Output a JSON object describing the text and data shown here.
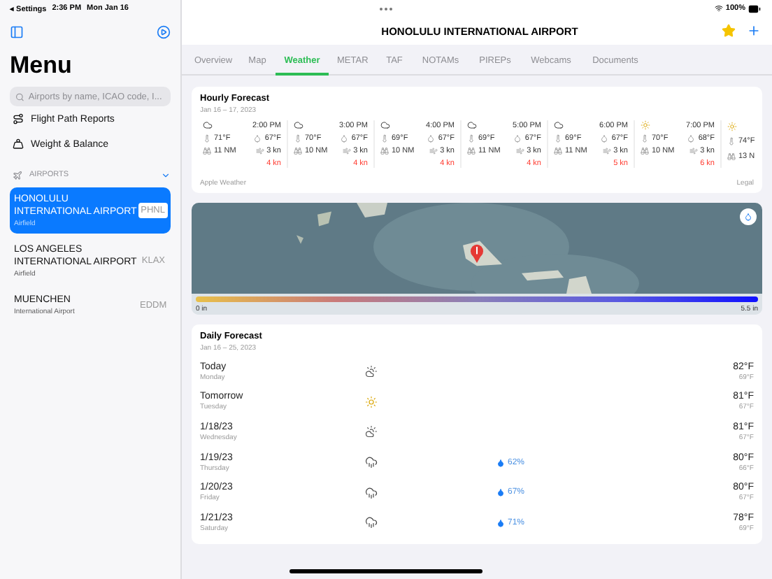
{
  "status_bar": {
    "back": "◂ Settings",
    "time": "2:36 PM",
    "date": "Mon Jan 16",
    "battery": "100%"
  },
  "sidebar": {
    "title": "Menu",
    "search": {
      "placeholder": "Airports by name, ICAO code, I..."
    },
    "items": [
      {
        "label": "Flight Path Reports",
        "kind": "route"
      },
      {
        "label": "Weight & Balance",
        "kind": "weight"
      }
    ],
    "section": {
      "label": "AIRPORTS",
      "expanded": true
    },
    "airports": [
      {
        "name": "HONOLULU INTERNATIONAL AIRPORT",
        "type": "Airfield",
        "code": "PHNL",
        "selected": true
      },
      {
        "name": "LOS ANGELES INTERNATIONAL AIRPORT",
        "type": "Airfield",
        "code": "KLAX",
        "selected": false
      },
      {
        "name": "MUENCHEN",
        "type": "International Airport",
        "code": "EDDM",
        "selected": false
      }
    ]
  },
  "header": {
    "title": "HONOLULU INTERNATIONAL AIRPORT",
    "favorite": true
  },
  "tabs": [
    {
      "label": "Overview",
      "selected": false
    },
    {
      "label": "Map",
      "selected": false
    },
    {
      "label": "Weather",
      "selected": true
    },
    {
      "label": "METAR",
      "selected": false
    },
    {
      "label": "TAF",
      "selected": false
    },
    {
      "label": "NOTAMs",
      "selected": false
    },
    {
      "label": "PIREPs",
      "selected": false
    },
    {
      "label": "Webcams",
      "selected": false
    },
    {
      "label": "Documents",
      "selected": false
    }
  ],
  "hourly": {
    "title": "Hourly Forecast",
    "range": "Jan 16 – 17, 2023",
    "source": "Apple Weather",
    "legal": "Legal",
    "hours": [
      {
        "kind": "cloudy",
        "time": "2:00 PM",
        "temp": "71°F",
        "dewpoint": "67°F",
        "visibility": "11 NM",
        "wind": "3 kn",
        "gust": "4 kn"
      },
      {
        "kind": "cloudy",
        "time": "3:00 PM",
        "temp": "70°F",
        "dewpoint": "67°F",
        "visibility": "10 NM",
        "wind": "3 kn",
        "gust": "4 kn"
      },
      {
        "kind": "cloudy",
        "time": "4:00 PM",
        "temp": "69°F",
        "dewpoint": "67°F",
        "visibility": "10 NM",
        "wind": "3 kn",
        "gust": "4 kn"
      },
      {
        "kind": "cloudy",
        "time": "5:00 PM",
        "temp": "69°F",
        "dewpoint": "67°F",
        "visibility": "11 NM",
        "wind": "3 kn",
        "gust": "4 kn"
      },
      {
        "kind": "cloudy",
        "time": "6:00 PM",
        "temp": "69°F",
        "dewpoint": "67°F",
        "visibility": "11 NM",
        "wind": "3 kn",
        "gust": "5 kn"
      },
      {
        "kind": "sunny",
        "time": "7:00 PM",
        "temp": "70°F",
        "dewpoint": "68°F",
        "visibility": "10 NM",
        "wind": "3 kn",
        "gust": "6 kn"
      },
      {
        "kind": "sunny",
        "temp": "74°F",
        "visibility": "13 N"
      }
    ]
  },
  "map": {
    "scale_min": "0 in",
    "scale_max": "5.5 in"
  },
  "daily": {
    "title": "Daily Forecast",
    "range": "Jan 16 – 25, 2023",
    "days": [
      {
        "date": "Today",
        "weekday": "Monday",
        "kind": "partly_cloudy",
        "high": "82°F",
        "low": "69°F"
      },
      {
        "date": "Tomorrow",
        "weekday": "Tuesday",
        "kind": "sunny",
        "high": "81°F",
        "low": "67°F"
      },
      {
        "date": "1/18/23",
        "weekday": "Wednesday",
        "kind": "partly_cloudy",
        "high": "81°F",
        "low": "67°F"
      },
      {
        "date": "1/19/23",
        "weekday": "Thursday",
        "kind": "rain",
        "precip": "62%",
        "high": "80°F",
        "low": "66°F"
      },
      {
        "date": "1/20/23",
        "weekday": "Friday",
        "kind": "rain",
        "precip": "67%",
        "high": "80°F",
        "low": "67°F"
      },
      {
        "date": "1/21/23",
        "weekday": "Saturday",
        "kind": "rain",
        "precip": "71%",
        "high": "78°F",
        "low": "69°F"
      }
    ]
  }
}
